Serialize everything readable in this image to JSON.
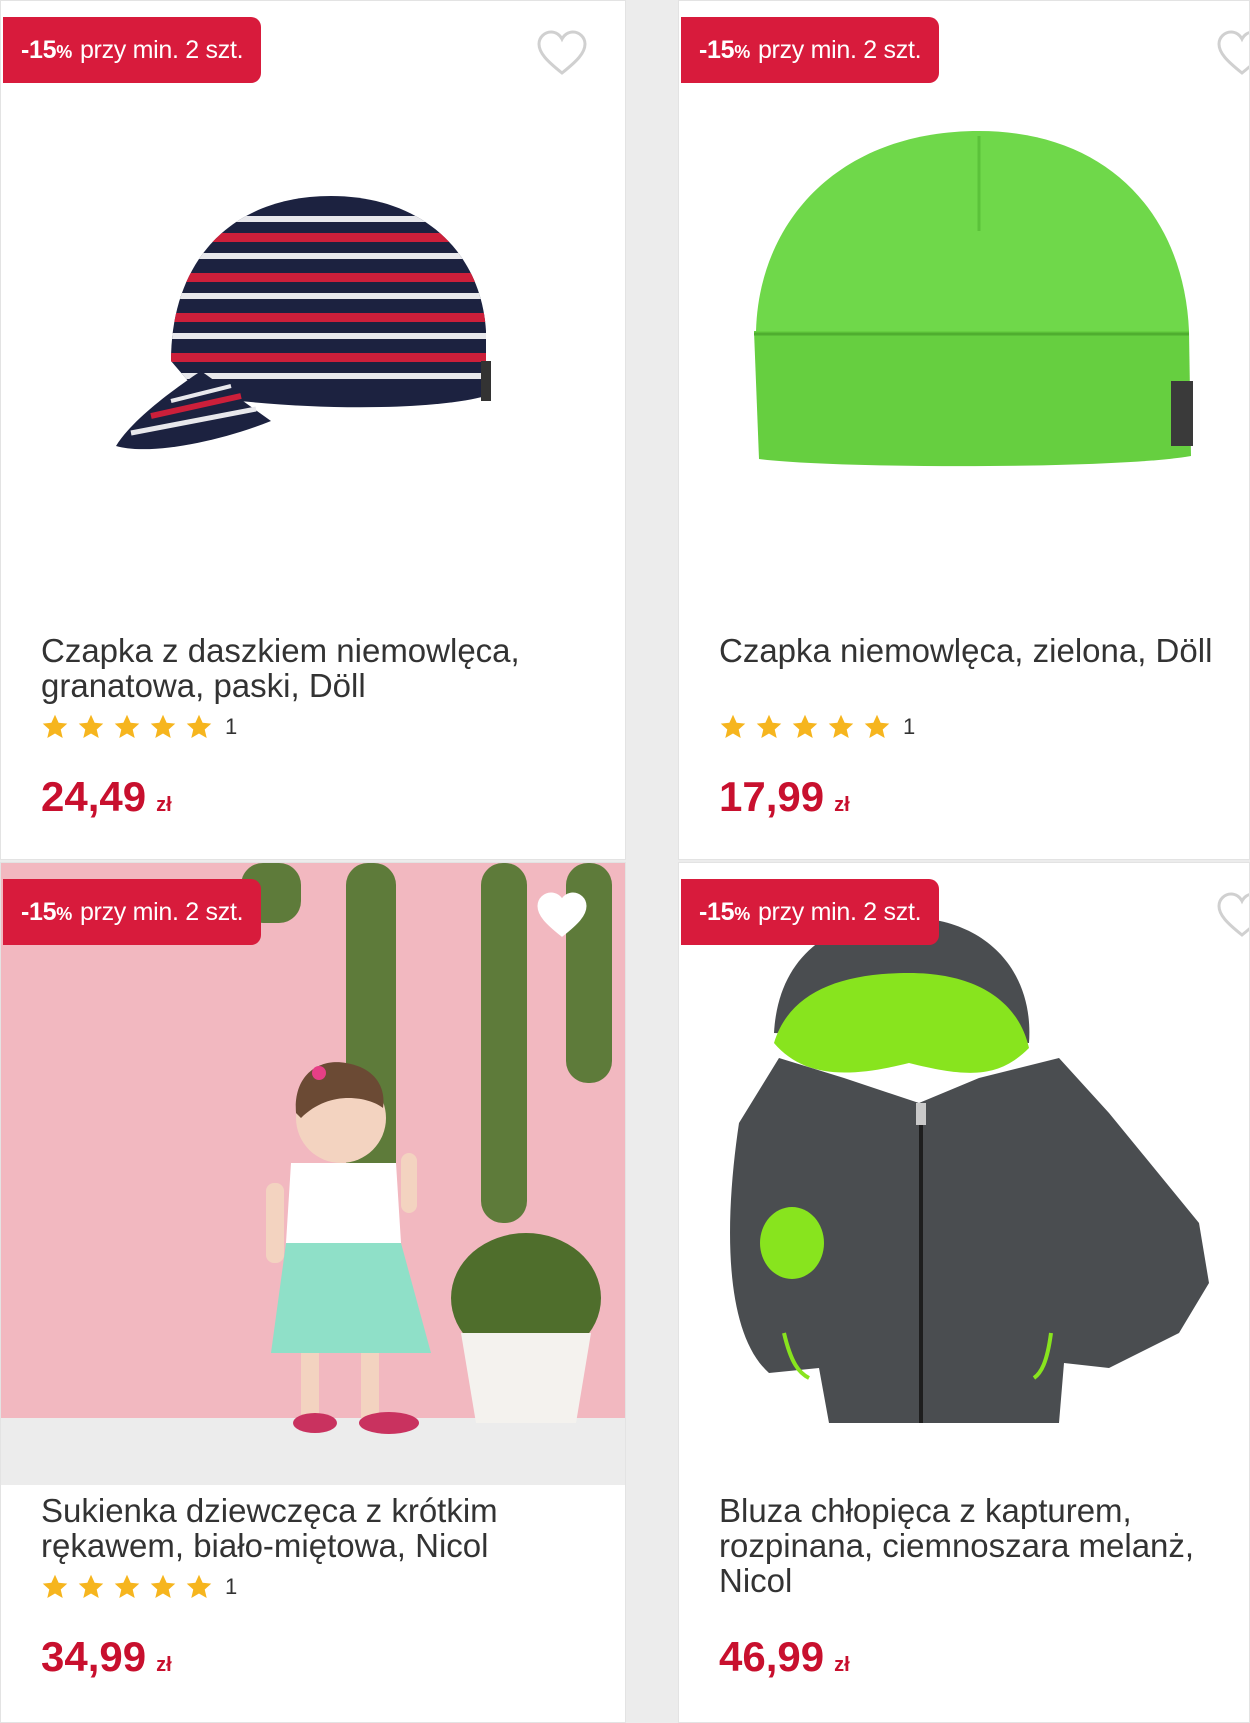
{
  "products": [
    {
      "badge_pct": "-15",
      "badge_pct_sign": "%",
      "badge_text": "przy min. 2 szt.",
      "title": "Czapka z daszkiem niemowlęca, granatowa, paski, Döll",
      "rating_count": "1",
      "price": "24,49",
      "currency": "zł"
    },
    {
      "badge_pct": "-15",
      "badge_pct_sign": "%",
      "badge_text": "przy min. 2 szt.",
      "title": "Czapka niemowlęca, zielona, Döll",
      "rating_count": "1",
      "price": "17,99",
      "currency": "zł"
    },
    {
      "badge_pct": "-15",
      "badge_pct_sign": "%",
      "badge_text": "przy min. 2 szt.",
      "title": "Sukienka dziewczęca z krótkim rękawem, biało-miętowa, Nicol",
      "rating_count": "1",
      "price": "34,99",
      "currency": "zł"
    },
    {
      "badge_pct": "-15",
      "badge_pct_sign": "%",
      "badge_text": "przy min. 2 szt.",
      "title": "Bluza chłopięca z kapturem, rozpinana, ciemnoszara melanż, Nicol",
      "rating_count": "",
      "price": "46,99",
      "currency": "zł"
    }
  ],
  "colors": {
    "badge": "#d81b3c",
    "price": "#c8102e",
    "star": "#f6b51e"
  },
  "icons": {
    "heart": "heart-outline-icon",
    "star": "star-icon"
  },
  "rating_stars": 5
}
